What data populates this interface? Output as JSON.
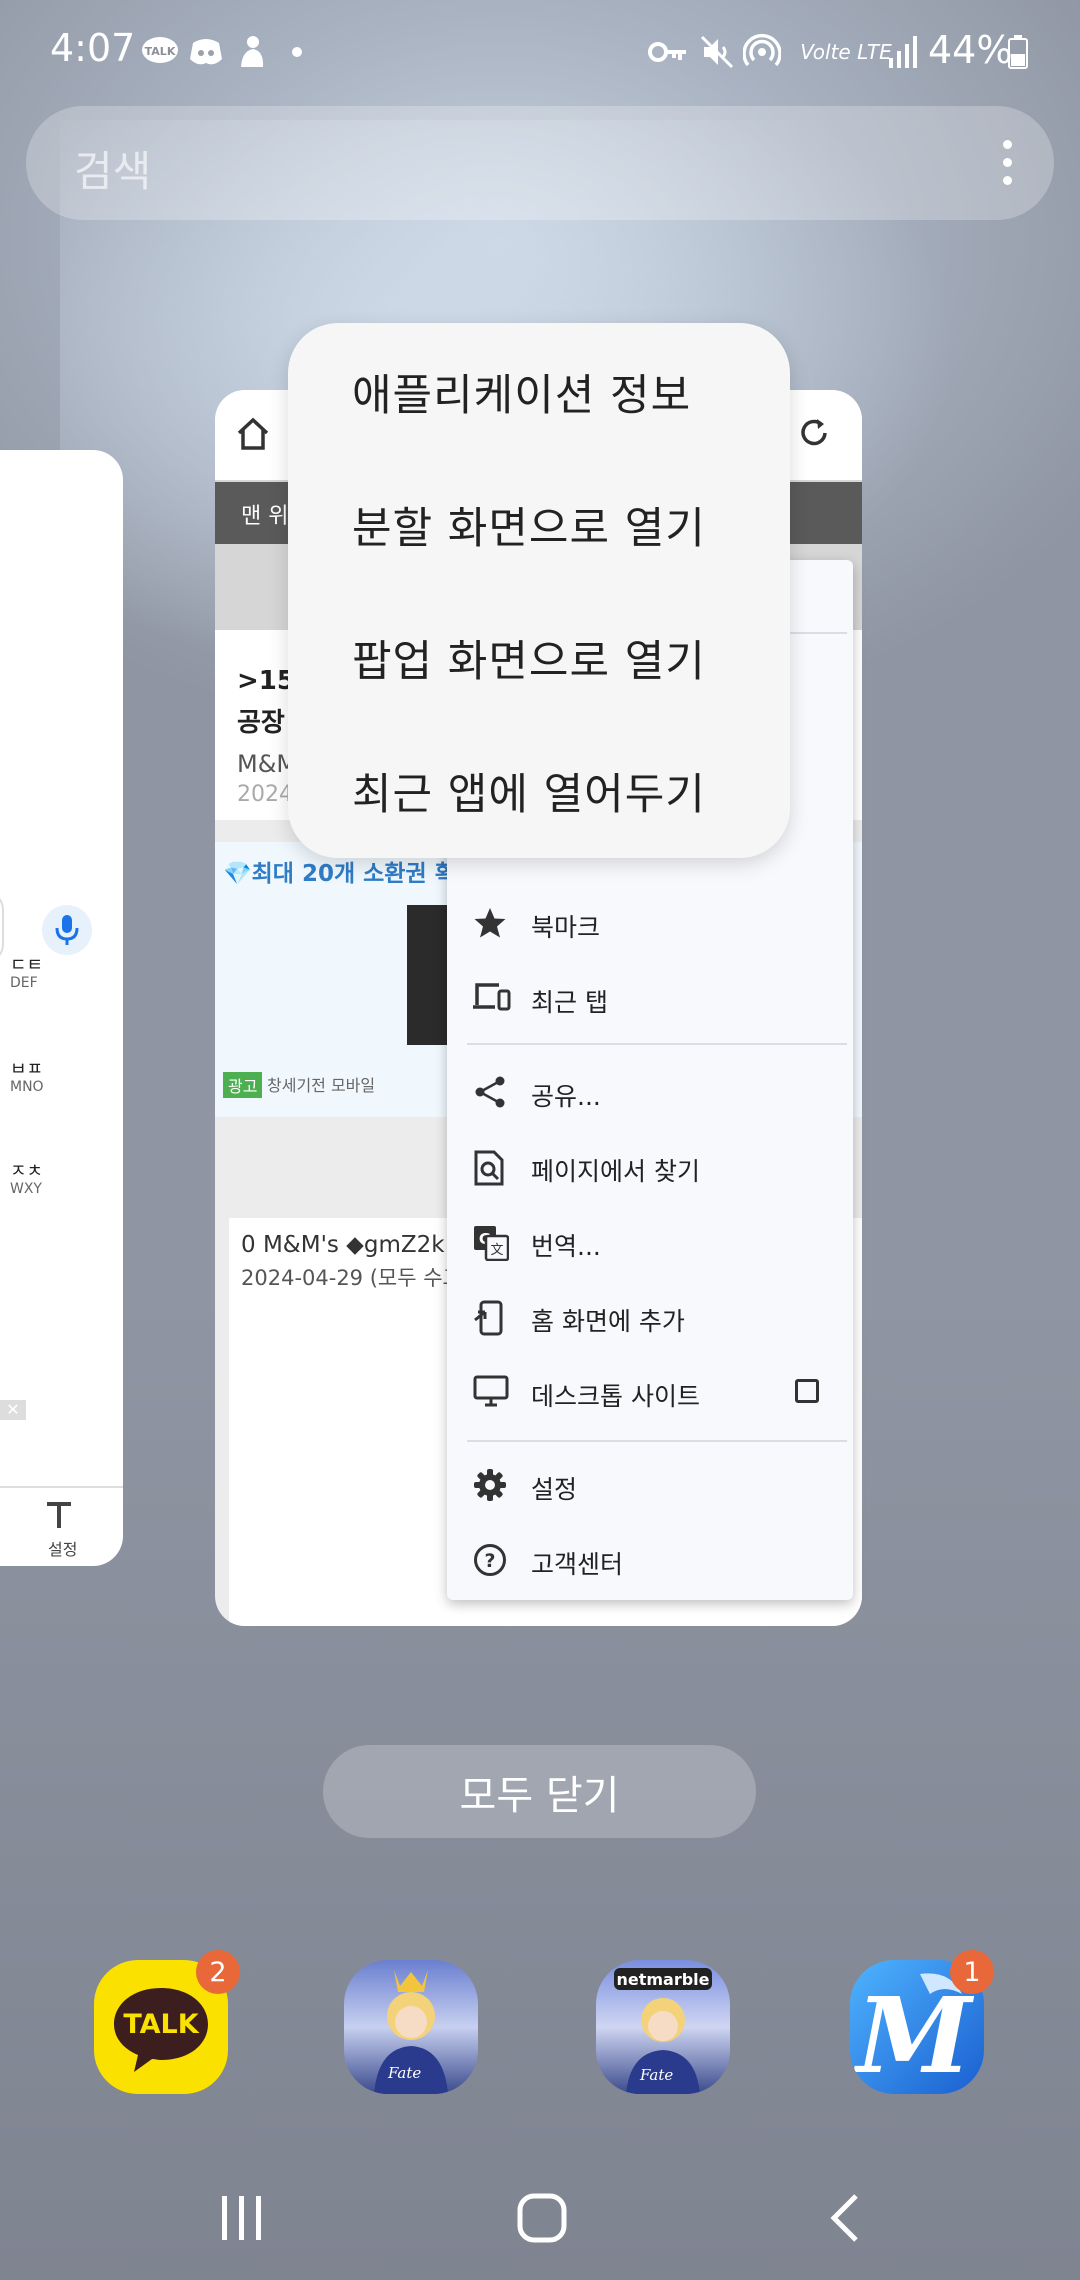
{
  "status_bar": {
    "time": "4:07",
    "network_label": "Volte LTE",
    "battery": "44%"
  },
  "search": {
    "placeholder": "검색"
  },
  "left_card": {
    "keys": [
      {
        "main": "ㄷㅌ",
        "sub": "DEF"
      },
      {
        "main": "ㅂㅍ",
        "sub": "MNO"
      },
      {
        "main": "ㅈㅊ",
        "sub": "WXY"
      }
    ],
    "settings_label": "설정"
  },
  "chrome_card": {
    "band_text": "맨 위",
    "article_title_1": ">15",
    "article_title_2": "공장",
    "article_source": "M&M",
    "article_date": "2024",
    "ad_title": "💎최대 20개 소환권 획",
    "ad_badge": "광고",
    "ad_source": "창세기전 모바일",
    "post_title": "0 M&M's ◆gmZ2k",
    "post_date": "2024-04-29 (모두 수고"
  },
  "chrome_menu": {
    "items": [
      {
        "icon": "star-icon",
        "label": "북마크"
      },
      {
        "icon": "recent-tabs-icon",
        "label": "최근 탭"
      },
      {
        "icon": "share-icon",
        "label": "공유..."
      },
      {
        "icon": "find-in-page-icon",
        "label": "페이지에서 찾기"
      },
      {
        "icon": "translate-icon",
        "label": "번역..."
      },
      {
        "icon": "add-to-home-icon",
        "label": "홈 화면에 추가"
      },
      {
        "icon": "desktop-icon",
        "label": "데스크톱 사이트"
      },
      {
        "icon": "gear-icon",
        "label": "설정"
      },
      {
        "icon": "help-icon",
        "label": "고객센터"
      }
    ],
    "desktop_site_checked": false
  },
  "app_popup": {
    "items": [
      "애플리케이션 정보",
      "분할 화면으로 열기",
      "팝업 화면으로 열기",
      "최근 앱에 열어두기"
    ]
  },
  "close_all_label": "모두 닫기",
  "dock": [
    {
      "name": "KakaoTalk",
      "label": "TALK",
      "badge": "2"
    },
    {
      "name": "Fate/Grand Order",
      "label": "Fate Grand Order",
      "badge": ""
    },
    {
      "name": "Fate/Grand Order netmarble",
      "label": "netmarble",
      "badge": ""
    },
    {
      "name": "M app",
      "label": "M",
      "badge": "1"
    }
  ],
  "colors": {
    "accent_blue": "#2f7cc7",
    "badge_orange": "#e8683a",
    "kakao_yellow": "#fae100"
  }
}
